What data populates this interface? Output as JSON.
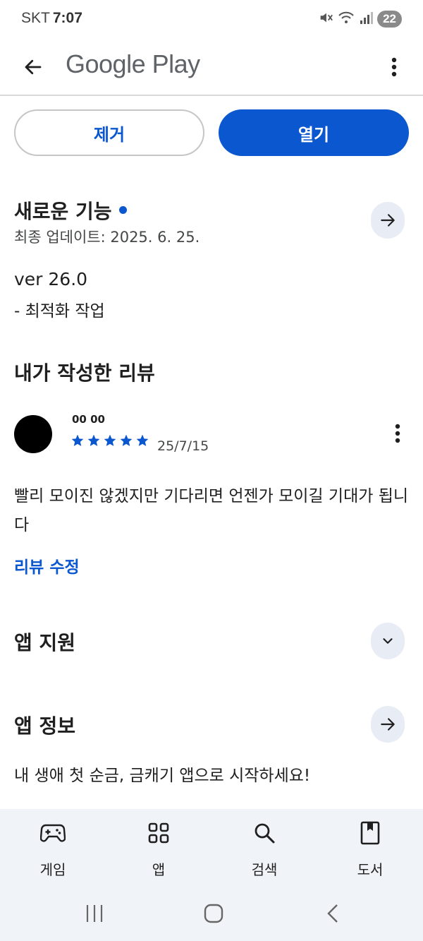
{
  "status": {
    "carrier": "SKT",
    "time": "7:07",
    "battery": "22"
  },
  "app_bar": {
    "title": "Google Play"
  },
  "actions": {
    "remove_label": "제거",
    "open_label": "열기"
  },
  "whats_new": {
    "title": "새로운 기능",
    "updated": "최종 업데이트: 2025. 6. 25.",
    "version": "ver 26.0",
    "notes": "- 최적화 작업"
  },
  "my_review": {
    "title": "내가 작성한 리뷰",
    "reviewer_name": "00 00",
    "rating": 5,
    "date": "25/7/15",
    "text": "빨리 모이진 않겠지만 기다리면 언젠가 모이길 기대가 됩니다",
    "edit_label": "리뷰 수정"
  },
  "app_support": {
    "title": "앱 지원"
  },
  "app_info": {
    "title": "앱 정보",
    "description": "내 생애 첫 순금, 금캐기 앱으로 시작하세요!"
  },
  "bottom_nav": [
    {
      "label": "게임",
      "icon": "gamepad-icon"
    },
    {
      "label": "앱",
      "icon": "apps-grid-icon"
    },
    {
      "label": "검색",
      "icon": "search-icon"
    },
    {
      "label": "도서",
      "icon": "book-icon"
    }
  ],
  "colors": {
    "accent": "#0b57d0",
    "nav_bg": "#f0f4f9",
    "circle_bg": "#e8ecf4"
  }
}
